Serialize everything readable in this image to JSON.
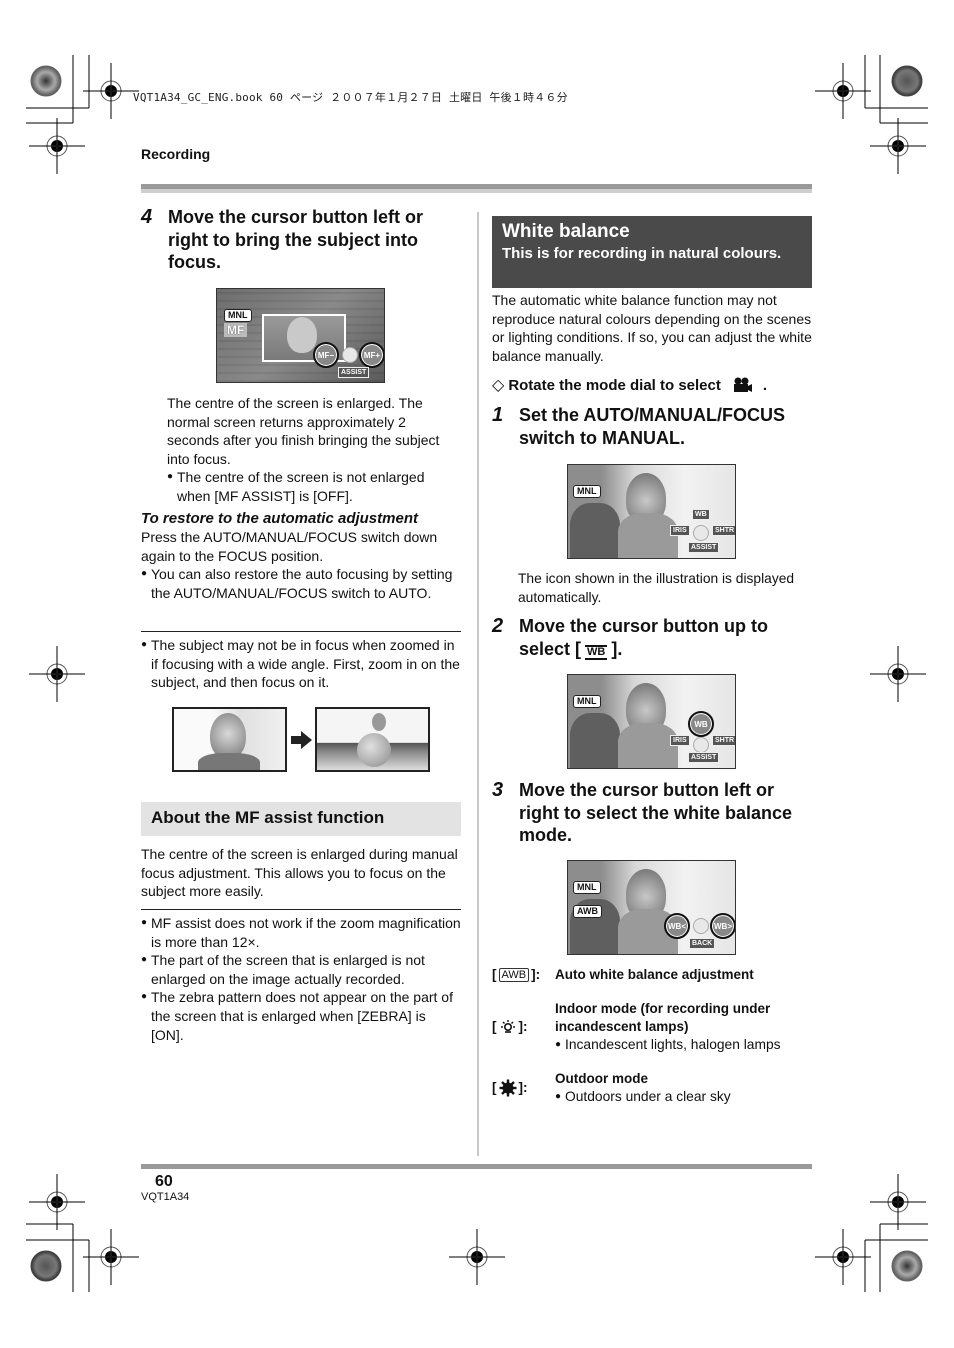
{
  "print_header": "VQT1A34_GC_ENG.book  60 ページ  ２００７年１月２７日  土曜日  午後１時４６分",
  "section": "Recording",
  "left_column": {
    "step4": {
      "number": "4",
      "title": "Move the cursor button left or right to bring the subject into focus.",
      "illustration": {
        "mode_tag": "MNL",
        "mf_label": "MF",
        "left_button": "MF−",
        "right_button": "MF+",
        "bottom_label": "ASSIST"
      },
      "description": "The centre of the screen is enlarged. The normal screen returns approximately 2 seconds after you finish bringing the subject into focus.",
      "bullet": "The centre of the screen is not enlarged when [MF ASSIST] is [OFF]."
    },
    "restore": {
      "heading": "To restore to the automatic adjustment",
      "text": "Press the AUTO/MANUAL/FOCUS switch down again to the FOCUS position.",
      "bullet": "You can also restore the auto focusing by setting the AUTO/MANUAL/FOCUS switch to AUTO."
    },
    "note": {
      "bullet": "The subject may not be in focus when zoomed in if focusing with a wide angle. First, zoom in on the subject, and then focus on it."
    },
    "mf_assist": {
      "heading": "About the MF assist function",
      "text": "The centre of the screen is enlarged during manual focus adjustment. This allows you to focus on the subject more easily.",
      "bullets": [
        "MF assist does not work if the zoom magnification is more than 12×.",
        "The part of the screen that is enlarged is not enlarged on the image actually recorded.",
        "The zebra pattern does not appear on the part of the screen that is enlarged when [ZEBRA] is [ON]."
      ]
    }
  },
  "right_column": {
    "header": {
      "title": "White balance",
      "subtitle": "This is for recording in natural colours."
    },
    "intro": "The automatic white balance function may not reproduce natural colours depending on the scenes or lighting conditions. If so, you can adjust the white balance manually.",
    "prereq": {
      "symbol": "◇",
      "text": "Rotate the mode dial to select",
      "icon": "video-camera-icon",
      "suffix": "."
    },
    "step1": {
      "number": "1",
      "title": "Set the AUTO/MANUAL/FOCUS switch to MANUAL.",
      "illustration": {
        "mode_tag": "MNL",
        "up": "WB",
        "left": "IRIS",
        "right": "SHTR",
        "down": "ASSIST"
      },
      "note": "The icon shown in the illustration is displayed automatically."
    },
    "step2": {
      "number": "2",
      "title_prefix": "Move the cursor button up to select [",
      "title_icon": "WB",
      "title_suffix": "].",
      "illustration": {
        "mode_tag": "MNL",
        "up": "WB",
        "left": "IRIS",
        "right": "SHTR",
        "down": "ASSIST"
      }
    },
    "step3": {
      "number": "3",
      "title": "Move the cursor button left or right to select the white balance mode.",
      "illustration": {
        "mode_tag": "MNL",
        "wb_tag": "AWB",
        "left": "WB<",
        "right": "WB>",
        "down": "BACK"
      }
    },
    "modes": [
      {
        "key_icon": "AWB",
        "title": "Auto white balance adjustment",
        "extra": "",
        "bullet": ""
      },
      {
        "key_icon": "indoor-lamp-icon",
        "title": "Indoor mode (for recording under",
        "extra": "incandescent lamps)",
        "bullet": "Incandescent lights, halogen lamps"
      },
      {
        "key_icon": "outdoor-sun-icon",
        "title": "Outdoor mode",
        "extra": "",
        "bullet": "Outdoors under a clear sky"
      }
    ]
  },
  "footer": {
    "page_number": "60",
    "model_code": "VQT1A34"
  }
}
